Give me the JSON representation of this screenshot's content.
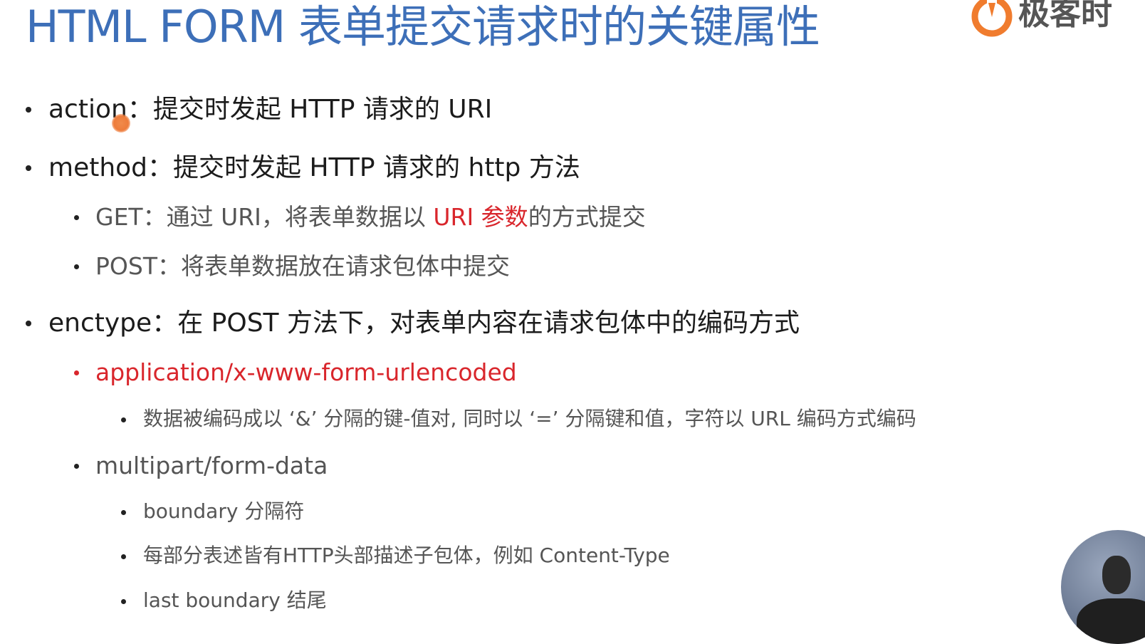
{
  "title": "HTML FORM 表单提交请求时的关键属性",
  "logo": {
    "text": "极客时",
    "mark": "geektime-logo-icon"
  },
  "items": {
    "action": {
      "key": "action",
      "sep": "：",
      "desc": "提交时发起 HTTP 请求的 URI"
    },
    "method": {
      "key": "method",
      "sep": "：",
      "desc": "提交时发起 HTTP 请求的 http 方法"
    },
    "get": {
      "pre": "GET：通过 URI，将表单数据以 ",
      "highlight": "URI 参数",
      "post": "的方式提交"
    },
    "post": {
      "text": "POST：将表单数据放在请求包体中提交"
    },
    "enctype": {
      "key": "enctype",
      "sep": "：",
      "desc": "在 POST 方法下，对表单内容在请求包体中的编码方式"
    },
    "urlencoded": {
      "text": "application/x-www-form-urlencoded"
    },
    "urlencoded_desc": {
      "text": "数据被编码成以 ‘&’ 分隔的键-值对, 同时以 ‘=’ 分隔键和值，字符以 URL 编码方式编码"
    },
    "multipart": {
      "text": "multipart/form-data"
    },
    "boundary": {
      "text": "boundary 分隔符"
    },
    "parts": {
      "text": "每部分表述皆有HTTP头部描述子包体，例如 Content-Type"
    },
    "last_boundary": {
      "text": "last boundary 结尾"
    }
  },
  "colors": {
    "title": "#3d6fb8",
    "highlight": "#d9262c",
    "logo_orange": "#f07c2e"
  }
}
